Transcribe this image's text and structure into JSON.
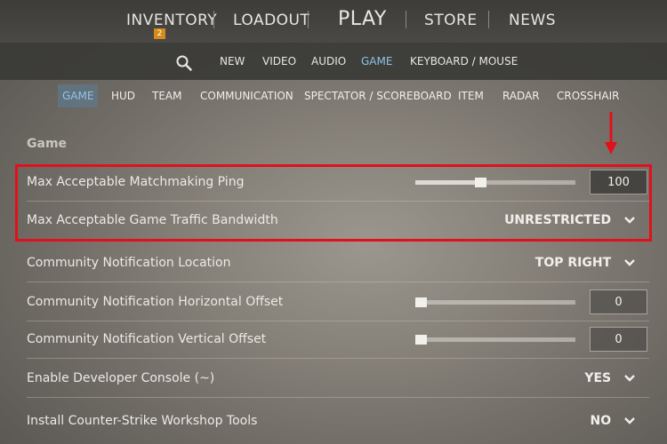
{
  "top_nav": {
    "items": [
      {
        "label": "INVENTORY",
        "badge": "2"
      },
      {
        "label": "LOADOUT"
      },
      {
        "label": "PLAY"
      },
      {
        "label": "STORE"
      },
      {
        "label": "NEWS"
      }
    ]
  },
  "settings_nav": {
    "search_icon": "search-icon",
    "items": [
      "NEW",
      "VIDEO",
      "AUDIO",
      "GAME",
      "KEYBOARD / MOUSE"
    ],
    "active": "GAME"
  },
  "game_tabs": {
    "items": [
      "GAME",
      "HUD",
      "TEAM",
      "COMMUNICATION",
      "SPECTATOR / SCOREBOARD",
      "ITEM",
      "RADAR",
      "CROSSHAIR"
    ],
    "active": "GAME"
  },
  "section": {
    "title": "Game"
  },
  "rows": [
    {
      "label": "Max Acceptable Matchmaking Ping",
      "type": "slider",
      "value": "100",
      "fraction": 0.4
    },
    {
      "label": "Max Acceptable Game Traffic Bandwidth",
      "type": "dropdown",
      "value": "UNRESTRICTED"
    },
    {
      "label": "Community Notification Location",
      "type": "dropdown",
      "value": "TOP RIGHT"
    },
    {
      "label": "Community Notification Horizontal Offset",
      "type": "slider",
      "value": "0",
      "fraction": 0.0
    },
    {
      "label": "Community Notification Vertical Offset",
      "type": "slider",
      "value": "0",
      "fraction": 0.0
    },
    {
      "label": "Enable Developer Console (~)",
      "type": "dropdown",
      "value": "YES"
    },
    {
      "label": "Install Counter-Strike Workshop Tools",
      "type": "dropdown",
      "value": "NO"
    }
  ],
  "colors": {
    "highlight": "#e3101b",
    "active_tab_text": "#8ec3e6",
    "badge": "#d58b19"
  }
}
